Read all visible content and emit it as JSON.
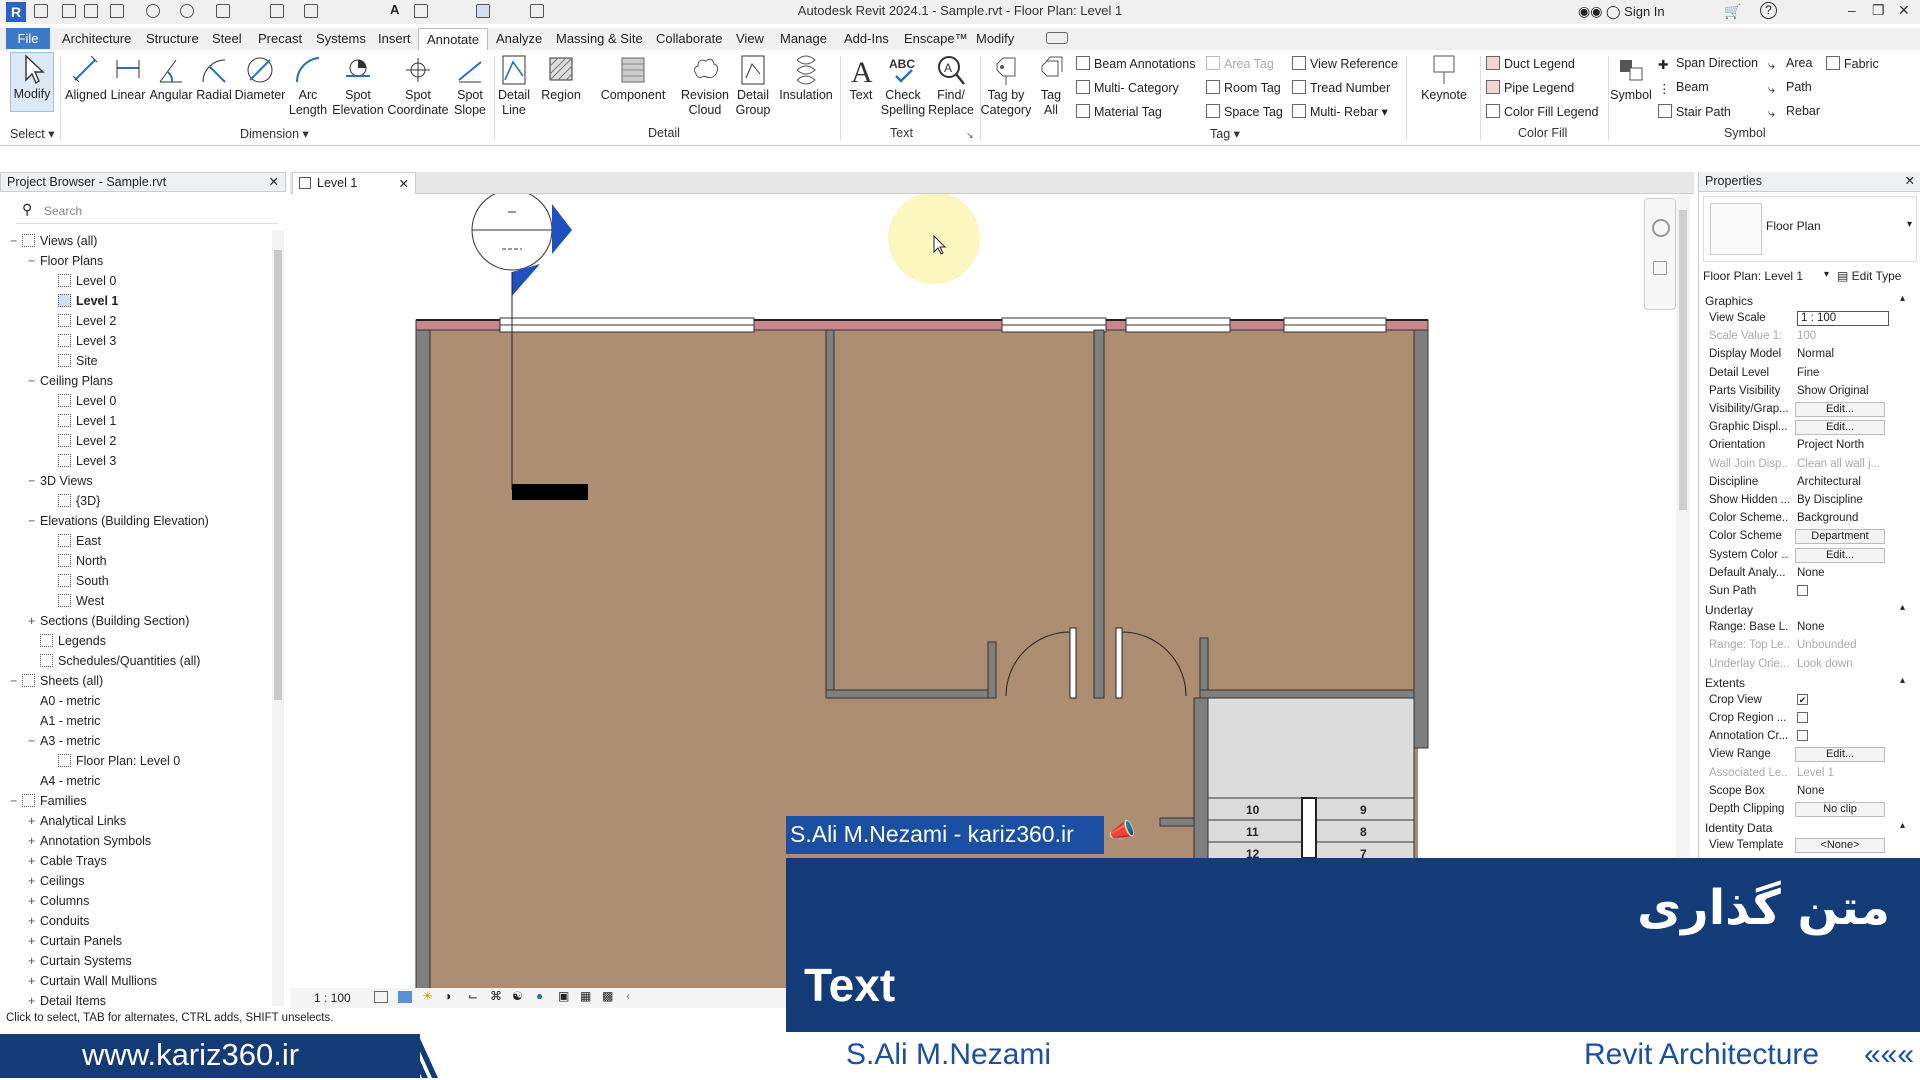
{
  "window": {
    "title": "Autodesk Revit 2024.1 - Sample.rvt - Floor Plan: Level 1",
    "sign_in": "Sign In"
  },
  "menu": {
    "file": "File",
    "tabs": [
      "Architecture",
      "Structure",
      "Steel",
      "Precast",
      "Systems",
      "Insert",
      "Annotate",
      "Analyze",
      "Massing & Site",
      "Collaborate",
      "View",
      "Manage",
      "Add-Ins",
      "Enscape™",
      "Modify"
    ]
  },
  "ribbon": {
    "select": {
      "modify": "Modify",
      "panel": "Select"
    },
    "dimension": {
      "items": [
        "Aligned",
        "Linear",
        "Angular",
        "Radial",
        "Diameter",
        "Arc Length",
        "Spot Elevation",
        "Spot Coordinate",
        "Spot Slope"
      ],
      "panel": "Dimension"
    },
    "detail": {
      "items": [
        "Detail Line",
        "Region",
        "Component",
        "Revision Cloud",
        "Detail Group",
        "Insulation"
      ],
      "panel": "Detail"
    },
    "text": {
      "items": [
        "Text",
        "Check Spelling",
        "Find/ Replace"
      ],
      "panel": "Text"
    },
    "tag": {
      "big": [
        "Tag by Category",
        "Tag All"
      ],
      "col1": [
        "Beam Annotations",
        "Multi- Category",
        "Material Tag"
      ],
      "col2": [
        "Area Tag",
        "Room Tag",
        "Space Tag"
      ],
      "col3": [
        "View Reference",
        "Tread Number",
        "Multi- Rebar"
      ],
      "panel": "Tag"
    },
    "keynote": "Keynote",
    "colorfill": {
      "items": [
        "Duct Legend",
        "Pipe Legend",
        "Color Fill Legend"
      ],
      "panel": "Color Fill"
    },
    "symbol": {
      "big": "Symbol",
      "col1": [
        "Span Direction",
        "Beam",
        "Stair Path"
      ],
      "col2": [
        "Area",
        "Path",
        "Rebar"
      ],
      "col3": [
        "Fabric"
      ],
      "panel": "Symbol"
    }
  },
  "project_browser": {
    "title": "Project Browser - Sample.rvt",
    "search_placeholder": "Search",
    "nodes": [
      "Views (all)",
      "Floor Plans",
      "Level 0",
      "Level 1",
      "Level 2",
      "Level 3",
      "Site",
      "Ceiling Plans",
      "Level 0",
      "Level 1",
      "Level 2",
      "Level 3",
      "3D Views",
      "{3D}",
      "Elevations (Building Elevation)",
      "East",
      "North",
      "South",
      "West",
      "Sections (Building Section)",
      "Legends",
      "Schedules/Quantities (all)",
      "Sheets (all)",
      "A0 - metric",
      "A1 - metric",
      "A3 - metric",
      "Floor Plan: Level 0",
      "A4 - metric",
      "Families",
      "Analytical Links",
      "Annotation Symbols",
      "Cable Trays",
      "Ceilings",
      "Columns",
      "Conduits",
      "Curtain Panels",
      "Curtain Systems",
      "Curtain Wall Mullions",
      "Detail Items"
    ]
  },
  "view": {
    "tab": "Level 1",
    "scale": "1 : 100",
    "stair_numbers": [
      "10",
      "9",
      "11",
      "8",
      "12",
      "7"
    ]
  },
  "status": "Click to select, TAB for alternates, CTRL adds, SHIFT unselects.",
  "properties": {
    "title": "Properties",
    "type": "Floor Plan",
    "selector": "Floor Plan: Level 1",
    "edit_type": "Edit Type",
    "sections": {
      "graphics": "Graphics",
      "underlay": "Underlay",
      "extents": "Extents",
      "identity": "Identity Data"
    },
    "rows": {
      "view_scale": [
        "View Scale",
        "1 : 100"
      ],
      "scale_value": [
        "Scale Value 1:",
        "100"
      ],
      "display_model": [
        "Display Model",
        "Normal"
      ],
      "detail_level": [
        "Detail Level",
        "Fine"
      ],
      "parts_visibility": [
        "Parts Visibility",
        "Show Original"
      ],
      "visibility_graphics": [
        "Visibility/Grap...",
        "Edit..."
      ],
      "graphic_display": [
        "Graphic Displ...",
        "Edit..."
      ],
      "orientation": [
        "Orientation",
        "Project North"
      ],
      "wall_join": [
        "Wall Join Disp...",
        "Clean all wall j..."
      ],
      "discipline": [
        "Discipline",
        "Architectural"
      ],
      "show_hidden": [
        "Show Hidden ...",
        "By Discipline"
      ],
      "color_scheme_loc": [
        "Color Scheme...",
        "Background"
      ],
      "color_scheme": [
        "Color Scheme",
        "Department"
      ],
      "system_color": [
        "System Color ...",
        "Edit..."
      ],
      "default_analysis": [
        "Default Analy...",
        "None"
      ],
      "sun_path": [
        "Sun Path",
        ""
      ],
      "range_base": [
        "Range: Base L...",
        "None"
      ],
      "range_top": [
        "Range: Top Le...",
        "Unbounded"
      ],
      "underlay_orient": [
        "Underlay Orie...",
        "Look down"
      ],
      "crop_view": [
        "Crop View",
        ""
      ],
      "crop_region": [
        "Crop Region ...",
        ""
      ],
      "annotation_crop": [
        "Annotation Cr...",
        ""
      ],
      "view_range": [
        "View Range",
        "Edit..."
      ],
      "associated_level": [
        "Associated Le...",
        "Level 1"
      ],
      "scope_box": [
        "Scope Box",
        "None"
      ],
      "depth_clipping": [
        "Depth Clipping",
        "No clip"
      ],
      "view_template": [
        "View Template",
        "<None>"
      ]
    }
  },
  "overlay": {
    "caption": "S.Ali  M.Nezami - kariz360.ir",
    "persian_title": "متن گذاری",
    "english_title": "Text"
  },
  "footer": {
    "website": "www.kariz360.ir",
    "author": "S.Ali   M.Nezami",
    "course": "Revit Architecture",
    "arrows": "«««"
  },
  "colors": {
    "accent": "#3a7ac9",
    "overlay_dark": "#123b77",
    "overlay_caption": "#1a4fa3",
    "floor_fill": "#ae8e72",
    "wall_gray": "#7f7f7f"
  }
}
